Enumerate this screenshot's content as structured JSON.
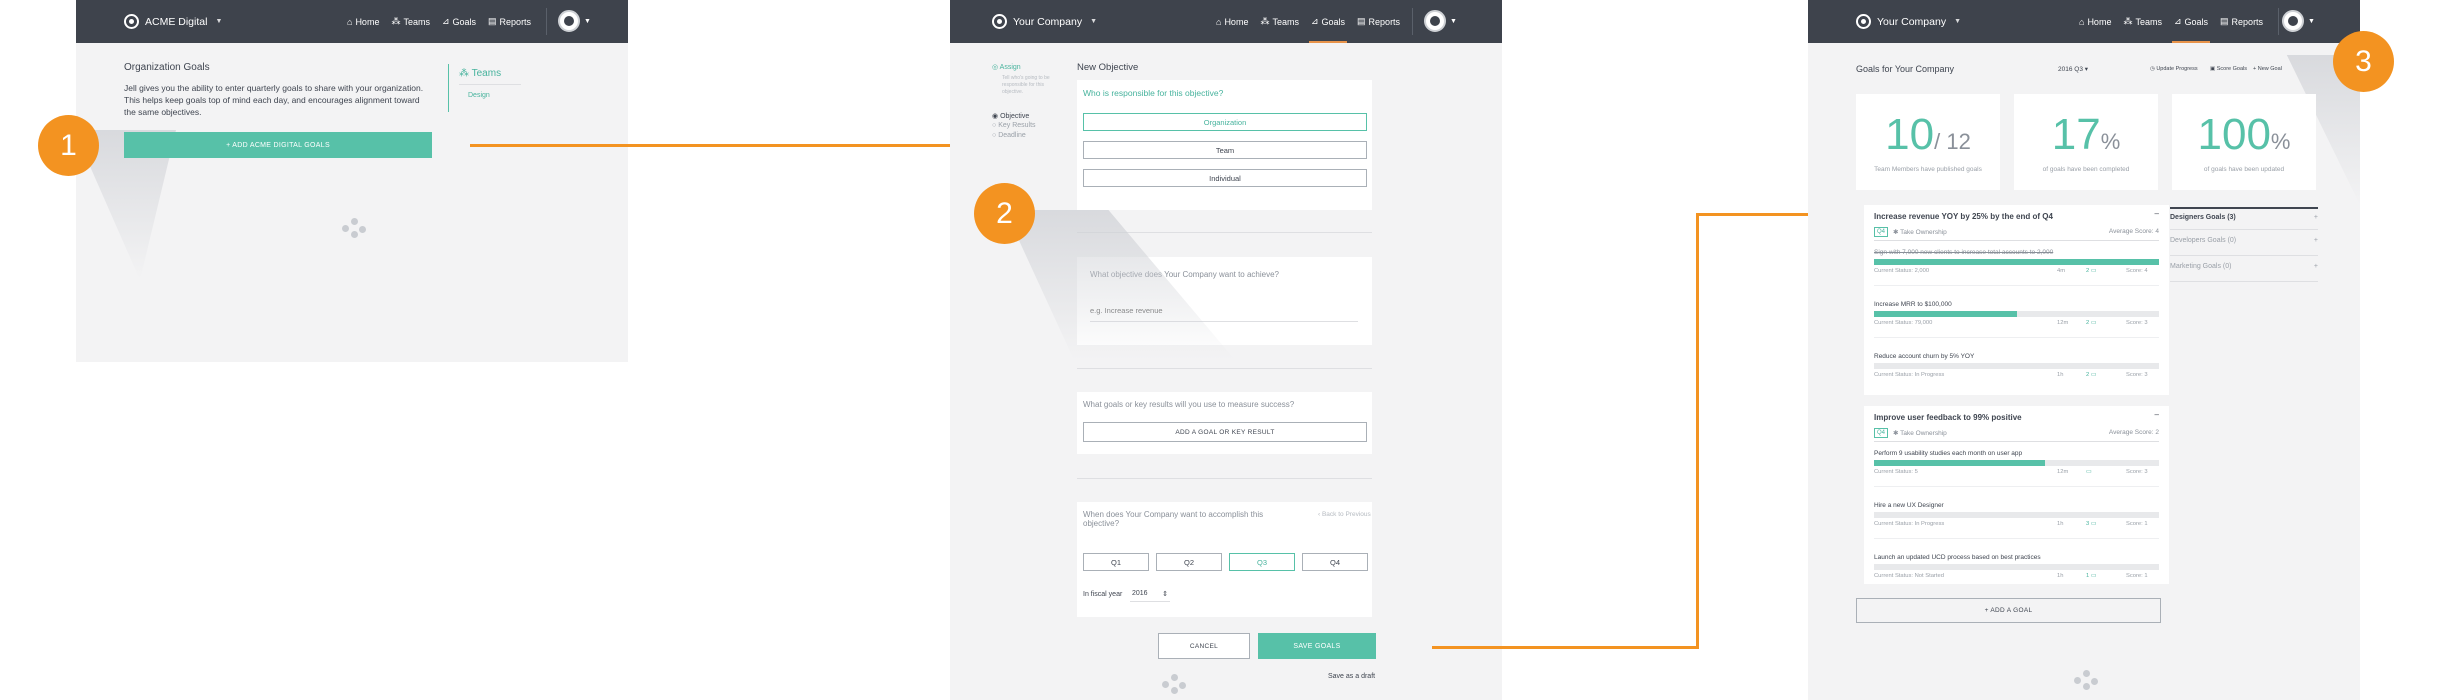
{
  "steps": [
    "1",
    "2",
    "3"
  ],
  "panel1": {
    "nav": {
      "brand": "ACME Digital",
      "links": [
        "Home",
        "Teams",
        "Goals",
        "Reports"
      ]
    },
    "heading": "Organization Goals",
    "body": "Jell gives you the ability to enter quarterly goals to share with your organization. This helps keep goals top of mind each day, and encourages alignment toward the same objectives.",
    "add_button": "+ ADD ACME DIGITAL GOALS",
    "side_title": "Teams",
    "side_item": "Design"
  },
  "panel2": {
    "nav": {
      "brand": "Your Company",
      "links": [
        "Home",
        "Teams",
        "Goals",
        "Reports"
      ],
      "active": "Goals"
    },
    "steps_nav": {
      "assign": "Assign",
      "assign_desc": "Tell who's going to be responsible for this objective.",
      "items": [
        "Objective",
        "Key Results",
        "Deadline"
      ]
    },
    "title": "New Objective",
    "q_responsible": "Who is responsible for this objective?",
    "options": [
      "Organization",
      "Team",
      "Individual"
    ],
    "q_objective": "What objective does Your Company want to achieve?",
    "objective_placeholder": "e.g. Increase revenue",
    "q_keyresults": "What goals or key results will you use to measure success?",
    "add_kr_button": "ADD A GOAL OR KEY RESULT",
    "q_when": "When does Your Company want to accomplish this objective?",
    "back_link": "‹ Back to Previous",
    "quarters": [
      "Q1",
      "Q2",
      "Q3",
      "Q4"
    ],
    "selected_quarter": "Q3",
    "fiscal_label": "In fiscal year",
    "fiscal_year": "2016",
    "cancel": "CANCEL",
    "save": "SAVE GOALS",
    "draft": "Save as a draft"
  },
  "panel3": {
    "nav": {
      "brand": "Your Company",
      "links": [
        "Home",
        "Teams",
        "Goals",
        "Reports"
      ],
      "active": "Goals"
    },
    "title": "Goals for Your Company",
    "period": "2016 Q3",
    "actions": [
      "Update Progress",
      "Score Goals",
      "New Goal"
    ],
    "stats": [
      {
        "value": "10",
        "suffix": "/ 12",
        "caption": "Team Members have published goals"
      },
      {
        "value": "17",
        "suffix": "%",
        "caption": "of goals have been completed"
      },
      {
        "value": "100",
        "suffix": "%",
        "caption": "of goals have been updated"
      }
    ],
    "objectives": [
      {
        "title": "Increase revenue YOY by 25% by the end of Q4",
        "quarter": "Q4",
        "owner": "Take Ownership",
        "score": "Average Score: 4",
        "results": [
          {
            "name": "Sign with 7,000 new clients to increase total accounts to 2,000",
            "status": "Current Status: 2,000",
            "progress": 1.0,
            "age": "4m",
            "comments": "2",
            "score": "Score: 4"
          },
          {
            "name": "Increase MRR to $100,000",
            "status": "Current Status: 79,000",
            "progress": 0.5,
            "age": "12m",
            "comments": "2",
            "score": "Score: 3"
          },
          {
            "name": "Reduce account churn by 5% YOY",
            "status": "Current Status: In Progress",
            "progress": 0,
            "age": "1h",
            "comments": "2",
            "score": "Score: 3"
          }
        ]
      },
      {
        "title": "Improve user feedback to 99% positive",
        "quarter": "Q4",
        "owner": "Take Ownership",
        "score": "Average Score: 2",
        "results": [
          {
            "name": "Perform 9 usability studies each month on user app",
            "status": "Current Status: 5",
            "progress": 0.6,
            "age": "12m",
            "comments": "",
            "score": "Score: 3"
          },
          {
            "name": "Hire a new UX Designer",
            "status": "Current Status: In Progress",
            "progress": 0,
            "age": "1h",
            "comments": "3",
            "score": "Score: 1"
          },
          {
            "name": "Launch an updated UCD process based on best practices",
            "status": "Current Status: Not Started",
            "progress": 0,
            "age": "1h",
            "comments": "1",
            "score": "Score: 1"
          }
        ]
      }
    ],
    "add_goal": "+ ADD A GOAL",
    "side": [
      {
        "label": "Designers Goals (3)",
        "icon": "minus"
      },
      {
        "label": "Developers Goals (0)",
        "icon": "plus"
      },
      {
        "label": "Marketing Goals (0)",
        "icon": "plus"
      }
    ]
  }
}
